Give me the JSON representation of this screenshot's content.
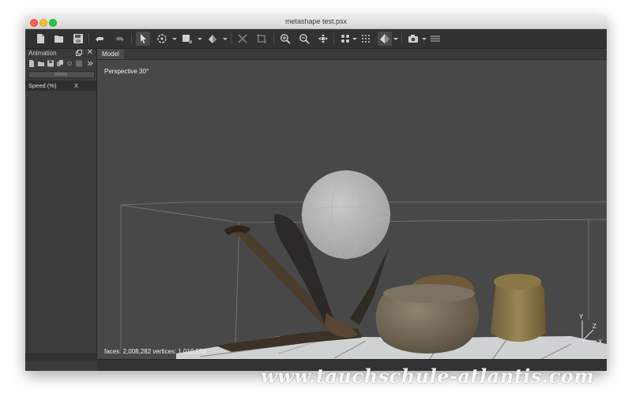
{
  "window": {
    "title": "metashape test.psx"
  },
  "toolbar": {
    "icons": [
      "new-file-icon",
      "open-folder-icon",
      "save-icon",
      "undo-icon",
      "redo-icon",
      "select-arrow-icon",
      "rotate-object-icon",
      "resize-region-icon",
      "move-region-icon",
      "delete-icon",
      "crop-icon",
      "zoom-in-icon",
      "zoom-out-icon",
      "navigation-icon",
      "point-cloud-icon",
      "dense-cloud-icon",
      "model-solid-icon",
      "camera-icon",
      "layers-icon"
    ]
  },
  "panel": {
    "title": "Animation",
    "close": "✕",
    "property": {
      "name": "Speed (%)",
      "value": "X"
    }
  },
  "viewport": {
    "tab": "Model",
    "projection_label": "Perspective 30°",
    "stats": "faces: 2,008,282 vertices: 1,010,558",
    "axes": {
      "y": "Y",
      "z": "Z",
      "x": "X"
    }
  },
  "watermark": "www.tauchschule-atlantis.com"
}
